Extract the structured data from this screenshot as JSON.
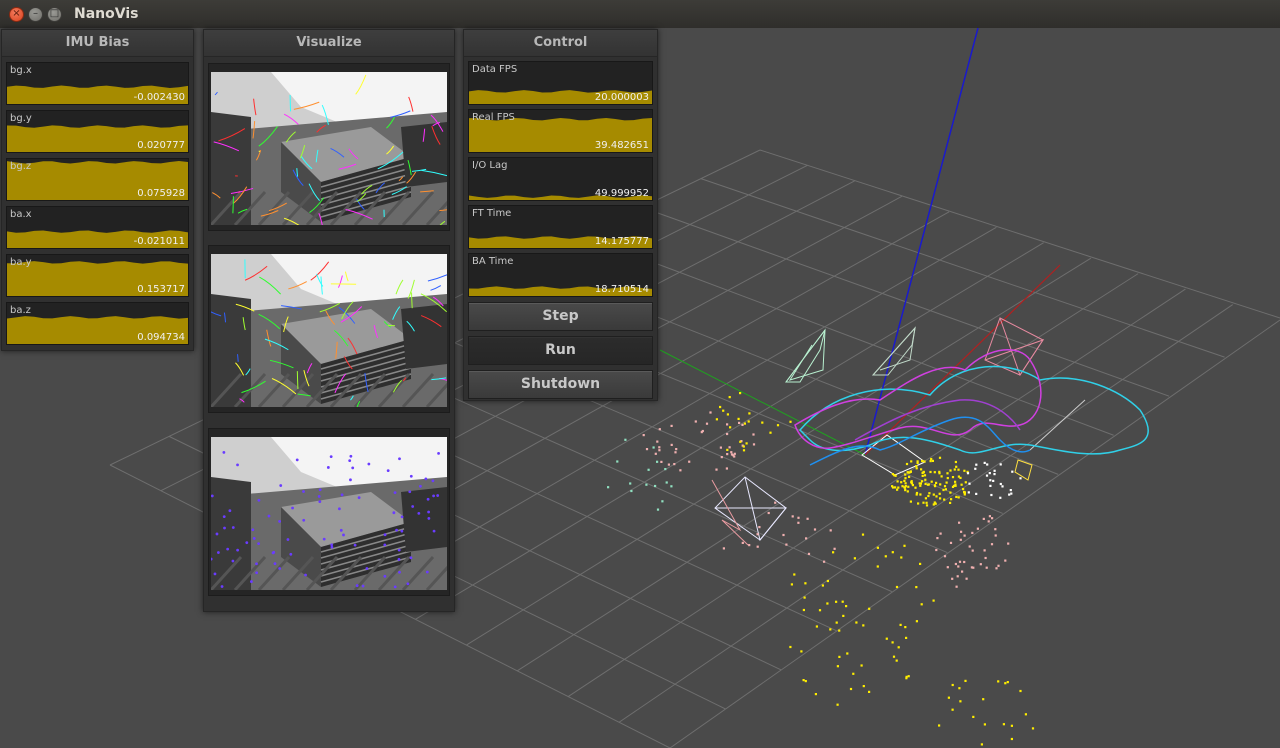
{
  "window": {
    "title": "NanoVis"
  },
  "colors": {
    "gauge_fill": "#a68b00",
    "gauge_bg": "#222222"
  },
  "imu_bias": {
    "title": "IMU Bias",
    "gauges": [
      {
        "label": "bg.x",
        "value": "-0.002430",
        "fill": 0.42
      },
      {
        "label": "bg.y",
        "value": "0.020777",
        "fill": 0.62
      },
      {
        "label": "bg.z",
        "value": "0.075928",
        "fill": 0.92
      },
      {
        "label": "ba.x",
        "value": "-0.021011",
        "fill": 0.4
      },
      {
        "label": "ba.y",
        "value": "0.153717",
        "fill": 0.82
      },
      {
        "label": "ba.z",
        "value": "0.094734",
        "fill": 0.65
      }
    ]
  },
  "visualize": {
    "title": "Visualize",
    "frames": [
      {
        "name": "feature-tracks-frame-1"
      },
      {
        "name": "feature-tracks-frame-2"
      },
      {
        "name": "feature-points-frame"
      }
    ]
  },
  "control": {
    "title": "Control",
    "gauges": [
      {
        "label": "Data FPS",
        "value": "20.000003",
        "fill": 0.3
      },
      {
        "label": "Real FPS",
        "value": "39.482651",
        "fill": 0.78
      },
      {
        "label": "I/O Lag",
        "value": "49.999952",
        "fill": 0.08
      },
      {
        "label": "FT Time",
        "value": "14.175777",
        "fill": 0.25
      },
      {
        "label": "BA Time",
        "value": "18.710514",
        "fill": 0.2
      }
    ],
    "buttons": {
      "step": "Step",
      "run": "Run",
      "shutdown": "Shutdown"
    }
  }
}
